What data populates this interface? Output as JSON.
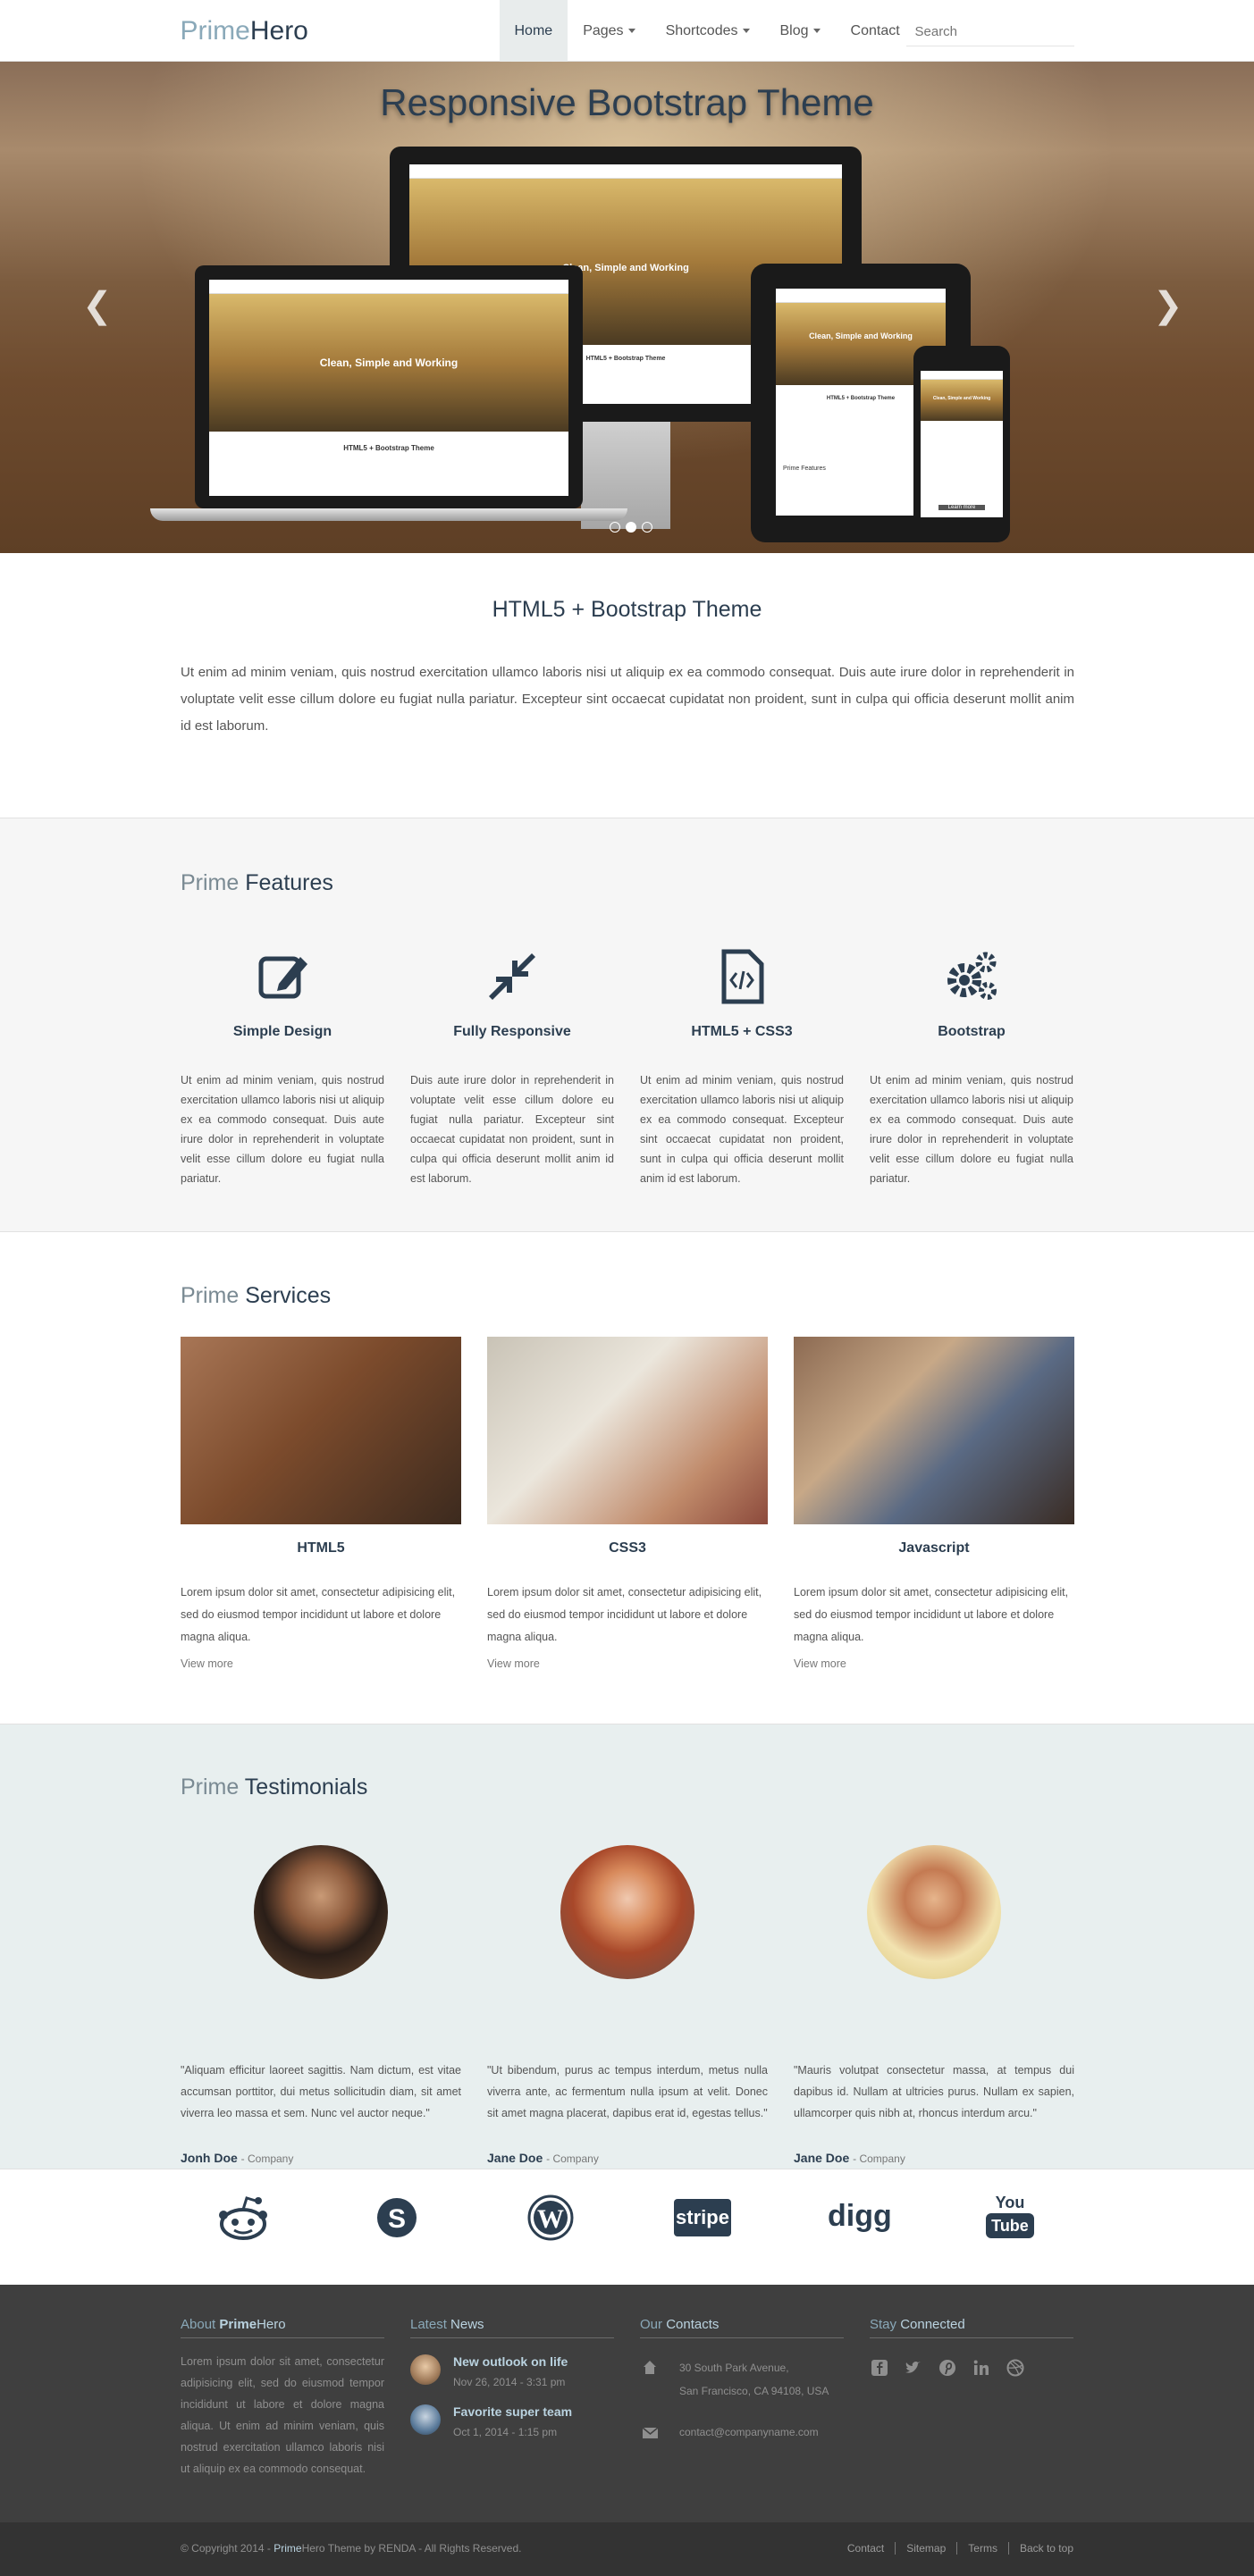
{
  "nav": {
    "brand_prime": "Prime",
    "brand_hero": "Hero",
    "items": [
      {
        "label": "Home"
      },
      {
        "label": "Pages"
      },
      {
        "label": "Shortcodes"
      },
      {
        "label": "Blog"
      },
      {
        "label": "Contact"
      }
    ],
    "search_placeholder": "Search"
  },
  "hero": {
    "title": "Responsive Bootstrap Theme",
    "screen_headline": "Clean, Simple and Working",
    "screen_section": "HTML5 + Bootstrap Theme",
    "phone_button": "Learn more",
    "tablet_features": "Prime Features"
  },
  "intro": {
    "title": "HTML5 + Bootstrap Theme",
    "text": "Ut enim ad minim veniam, quis nostrud exercitation ullamco laboris nisi ut aliquip ex ea commodo consequat. Duis aute irure dolor in reprehenderit in voluptate velit esse cillum dolore eu fugiat nulla pariatur. Excepteur sint occaecat cupidatat non proident, sunt in culpa qui officia deserunt mollit anim id est laborum."
  },
  "features": {
    "title_prefix": "Prime",
    "title_main": "Features",
    "items": [
      {
        "title": "Simple Design",
        "icon": "edit-icon",
        "text": "Ut enim ad minim veniam, quis nostrud exercitation ullamco laboris nisi ut aliquip ex ea commodo consequat. Duis aute irure dolor in reprehenderit in voluptate velit esse cillum dolore eu fugiat nulla pariatur."
      },
      {
        "title": "Fully Responsive",
        "icon": "compress-icon",
        "text": "Duis aute irure dolor in reprehenderit in voluptate velit esse cillum dolore eu fugiat nulla pariatur. Excepteur sint occaecat cupidatat non proident, sunt in culpa qui officia deserunt mollit anim id est laborum."
      },
      {
        "title": "HTML5 + CSS3",
        "icon": "code-file-icon",
        "text": "Ut enim ad minim veniam, quis nostrud exercitation ullamco laboris nisi ut aliquip ex ea commodo consequat. Excepteur sint occaecat cupidatat non proident, sunt in culpa qui officia deserunt mollit anim id est laborum."
      },
      {
        "title": "Bootstrap",
        "icon": "gears-icon",
        "text": "Ut enim ad minim veniam, quis nostrud exercitation ullamco laboris nisi ut aliquip ex ea commodo consequat. Duis aute irure dolor in reprehenderit in voluptate velit esse cillum dolore eu fugiat nulla pariatur."
      }
    ]
  },
  "services": {
    "title_prefix": "Prime",
    "title_main": "Services",
    "items": [
      {
        "title": "HTML5",
        "text": "Lorem ipsum dolor sit amet, consectetur adipisicing elit, sed do eiusmod tempor incididunt ut labore et dolore magna aliqua.",
        "link": "View more"
      },
      {
        "title": "CSS3",
        "text": "Lorem ipsum dolor sit amet, consectetur adipisicing elit, sed do eiusmod tempor incididunt ut labore et dolore magna aliqua.",
        "link": "View more"
      },
      {
        "title": "Javascript",
        "text": "Lorem ipsum dolor sit amet, consectetur adipisicing elit, sed do eiusmod tempor incididunt ut labore et dolore magna aliqua.",
        "link": "View more"
      }
    ]
  },
  "testimonials": {
    "title_prefix": "Prime",
    "title_main": "Testimonials",
    "items": [
      {
        "quote": "\"Aliquam efficitur laoreet sagittis. Nam dictum, est vitae accumsan porttitor, dui metus sollicitudin diam, sit amet viverra leo massa et sem. Nunc vel auctor neque.\"",
        "name": "Jonh Doe",
        "company": "- Company"
      },
      {
        "quote": "\"Ut bibendum, purus ac tempus interdum, metus nulla viverra ante, ac fermentum nulla ipsum at velit. Donec sit amet magna placerat, dapibus erat id, egestas tellus.\"",
        "name": "Jane Doe",
        "company": "- Company"
      },
      {
        "quote": "\"Mauris volutpat consectetur massa, at tempus dui dapibus id. Nullam at ultricies purus. Nullam ex sapien, ullamcorper quis nibh at, rhoncus interdum arcu.\"",
        "name": "Jane Doe",
        "company": "- Company"
      }
    ]
  },
  "brands": {
    "items": [
      "reddit-icon",
      "skype-icon",
      "wordpress-icon",
      "stripe-icon",
      "digg-icon",
      "youtube-icon"
    ],
    "stripe_text": "stripe",
    "digg_text": "digg",
    "youtube_you": "You",
    "youtube_tube": "Tube"
  },
  "footer": {
    "about_prefix": "About",
    "about_prime": "Prime",
    "about_hero": "Hero",
    "about_text": "Lorem ipsum dolor sit amet, consectetur adipisicing elit, sed do eiusmod tempor incididunt ut labore et dolore magna aliqua. Ut enim ad minim veniam, quis nostrud exercitation ullamco laboris nisi ut aliquip ex ea commodo consequat.",
    "news_prefix": "Latest",
    "news_main": "News",
    "news": [
      {
        "title": "New outlook on life",
        "date": "Nov 26, 2014 - 3:31 pm"
      },
      {
        "title": "Favorite super team",
        "date": "Oct 1, 2014 - 1:15 pm"
      }
    ],
    "contacts_prefix": "Our",
    "contacts_main": "Contacts",
    "address_line1": "30 South Park Avenue,",
    "address_line2": "San Francisco, CA 94108, USA",
    "email": "contact@companyname.com",
    "stay_prefix": "Stay",
    "stay_main": "Connected",
    "social": [
      "facebook-icon",
      "twitter-icon",
      "pinterest-icon",
      "linkedin-icon",
      "dribbble-icon"
    ]
  },
  "copyright": {
    "prefix": "© Copyright 2014 -",
    "prime": "Prime",
    "suffix": "Hero Theme by RENDA - All Rights Reserved.",
    "links": [
      "Contact",
      "Sitemap",
      "Terms",
      "Back to top"
    ]
  },
  "colors": {
    "primary": "#2c3e50",
    "accent": "#8aa9b9",
    "footer_bg": "#3f3f3f",
    "features_bg": "#f6f6f6",
    "testimonials_bg": "#e8efef"
  }
}
